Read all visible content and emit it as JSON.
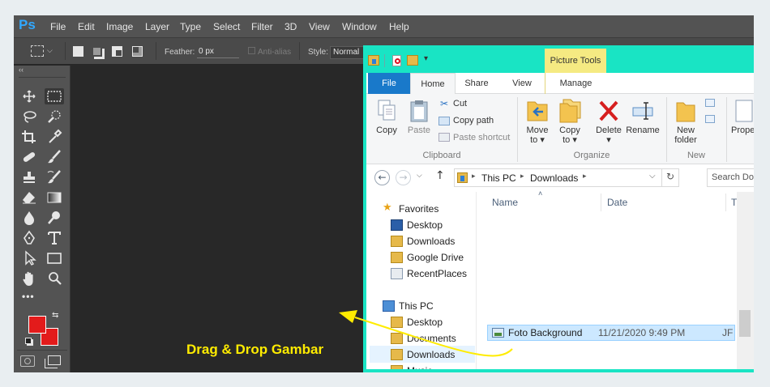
{
  "photoshop": {
    "logo": "Ps",
    "menu": [
      "File",
      "Edit",
      "Image",
      "Layer",
      "Type",
      "Select",
      "Filter",
      "3D",
      "View",
      "Window",
      "Help"
    ],
    "options": {
      "feather_label": "Feather:",
      "feather_value": "0 px",
      "antialias_label": "Anti-alias",
      "style_label": "Style:",
      "style_value": "Normal"
    },
    "toolbox_collapse": "‹‹",
    "more_tools": "•••",
    "foreground_color": "#e31b1b",
    "background_color": "#e31b1b"
  },
  "explorer": {
    "contextual_tab": "Picture Tools",
    "tabs": [
      "File",
      "Home",
      "Share",
      "View",
      "Manage"
    ],
    "ribbon": {
      "copy": "Copy",
      "paste": "Paste",
      "cut": "Cut",
      "copy_path": "Copy path",
      "paste_shortcut": "Paste shortcut",
      "group_clipboard": "Clipboard",
      "move_to": "Move",
      "move_to_2": "to ▾",
      "copy_to": "Copy",
      "copy_to_2": "to ▾",
      "delete": "Delete",
      "delete_2": "▾",
      "rename": "Rename",
      "group_organize": "Organize",
      "new_folder": "New",
      "new_folder_2": "folder",
      "group_new": "New",
      "properties": "Prope"
    },
    "address": {
      "path": [
        "This PC",
        "Downloads"
      ],
      "search_placeholder": "Search Do"
    },
    "nav": {
      "favorites": "Favorites",
      "favorites_items": [
        "Desktop",
        "Downloads",
        "Google Drive",
        "RecentPlaces"
      ],
      "this_pc": "This PC",
      "this_pc_items": [
        "Desktop",
        "Documents",
        "Downloads",
        "Music"
      ]
    },
    "columns": [
      "Name",
      "Date",
      "T"
    ],
    "file": {
      "name": "Foto Background",
      "date": "11/21/2020 9:49 PM",
      "type": "JF"
    }
  },
  "annotation": {
    "label": "Drag & Drop Gambar",
    "color": "#ffec00"
  }
}
